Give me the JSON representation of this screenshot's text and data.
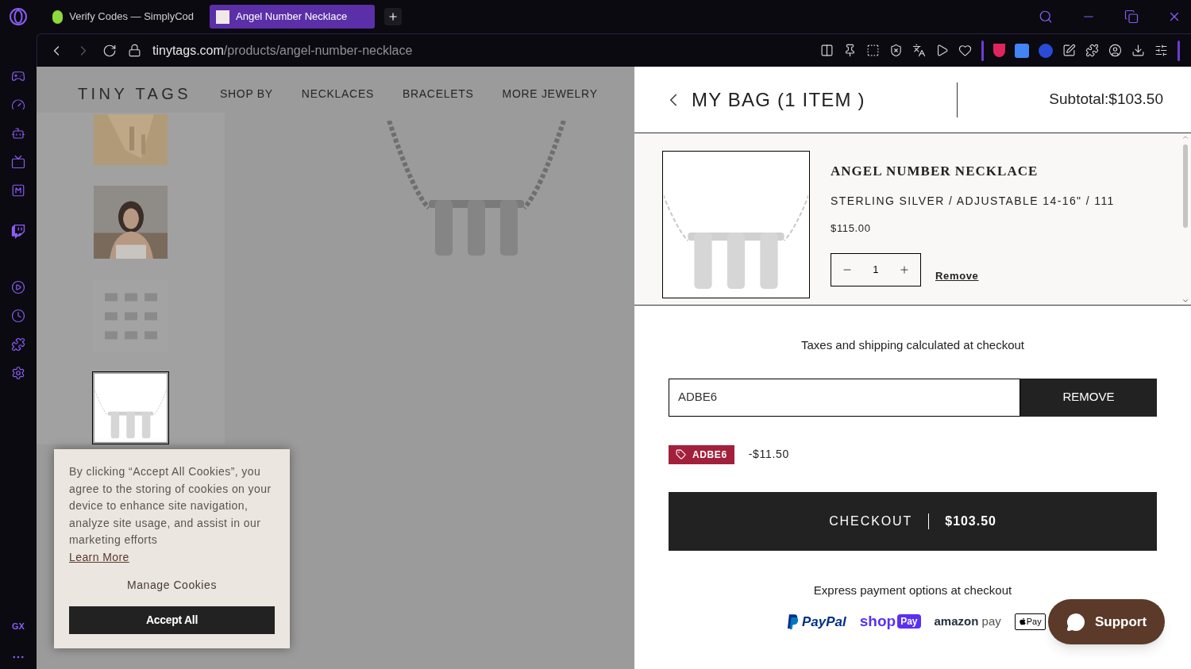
{
  "browser": {
    "tabs": [
      {
        "title": "Verify Codes — SimplyCod",
        "selected": false
      },
      {
        "title": "Angel Number Necklace",
        "selected": true
      }
    ],
    "address": {
      "domain": "tinytags.com",
      "path": "/products/angel-number-necklace"
    },
    "sidebar_label": "GX"
  },
  "page": {
    "logo": "TINY TAGS",
    "nav": [
      "SHOP BY",
      "NECKLACES",
      "BRACELETS",
      "MORE JEWELRY"
    ],
    "thumbnails": [
      {
        "selected": false
      },
      {
        "selected": false
      },
      {
        "selected": false
      },
      {
        "selected": true
      }
    ],
    "cookie_banner": {
      "text": "By clicking “Accept All Cookies”, you agree to the storing of cookies on your device to enhance site navigation, analyze site usage, and assist in our marketing efforts",
      "link": "Learn More",
      "manage": "Manage Cookies",
      "accept": "Accept All"
    }
  },
  "cart": {
    "title": "MY BAG (1 ITEM )",
    "subtotal": "Subtotal:$103.50",
    "items": [
      {
        "name": "ANGEL NUMBER NECKLACE",
        "variant": "STERLING SILVER / ADJUSTABLE 14-16\" / 111",
        "price": "$115.00",
        "quantity": "1",
        "remove": "Remove"
      }
    ],
    "taxes_note": "Taxes and shipping calculated at checkout",
    "coupon": {
      "value": "ADBE6",
      "button": "REMOVE"
    },
    "discounts": [
      {
        "code": "ADBE6",
        "amount": "-$11.50",
        "color": "#a3203c"
      }
    ],
    "checkout": {
      "label": "CHECKOUT",
      "total": "$103.50"
    },
    "express_note": "Express payment options at checkout",
    "payment_logos": [
      {
        "kind": "paypal",
        "text": "PayPal"
      },
      {
        "kind": "shoppay",
        "text": "shop",
        "badge": "Pay"
      },
      {
        "kind": "amazon",
        "text": "amazon",
        "suffix": "pay"
      },
      {
        "kind": "applepay",
        "text": "Pay"
      }
    ],
    "support": "Support"
  }
}
